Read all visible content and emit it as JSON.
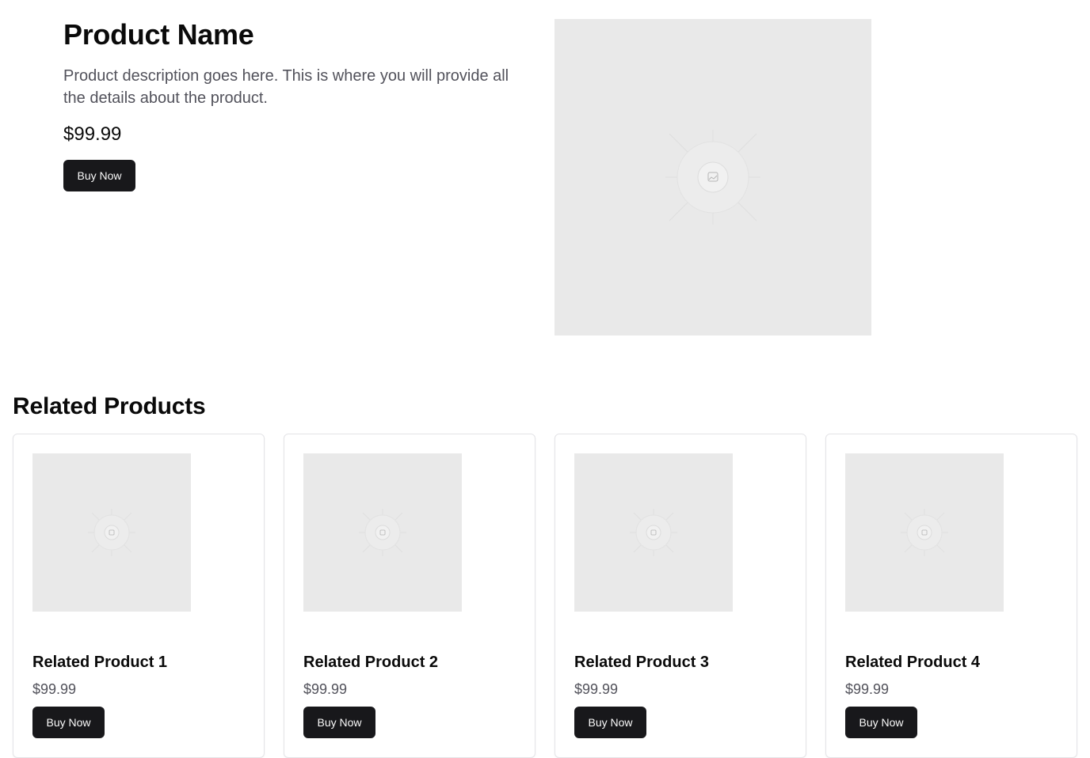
{
  "product": {
    "title": "Product Name",
    "description": "Product description goes here. This is where you will provide all the details about the product.",
    "price": "$99.99",
    "buy_label": "Buy Now",
    "image_icon": "image-placeholder-icon"
  },
  "related": {
    "heading": "Related Products",
    "items": [
      {
        "name": "Related Product 1",
        "price": "$99.99",
        "buy_label": "Buy Now"
      },
      {
        "name": "Related Product 2",
        "price": "$99.99",
        "buy_label": "Buy Now"
      },
      {
        "name": "Related Product 3",
        "price": "$99.99",
        "buy_label": "Buy Now"
      },
      {
        "name": "Related Product 4",
        "price": "$99.99",
        "buy_label": "Buy Now"
      }
    ]
  },
  "colors": {
    "button_bg": "#18181b",
    "button_text": "#fafafa",
    "placeholder_bg": "#e9e9e9",
    "muted_text": "#52525b",
    "card_border": "#e4e4e7"
  }
}
